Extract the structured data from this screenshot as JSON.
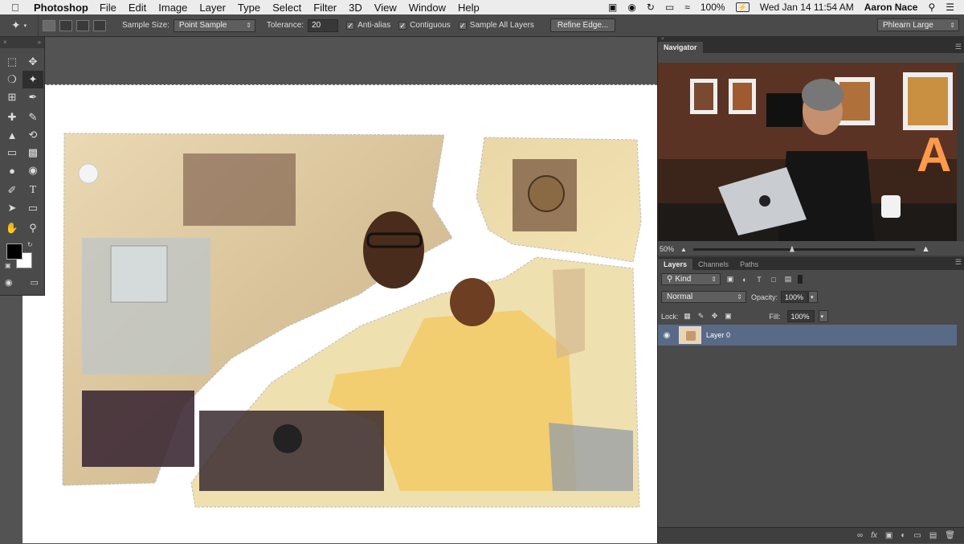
{
  "menubar": {
    "app_name": "Photoshop",
    "menus": [
      "File",
      "Edit",
      "Image",
      "Layer",
      "Type",
      "Select",
      "Filter",
      "3D",
      "View",
      "Window",
      "Help"
    ],
    "battery": "100%",
    "datetime": "Wed Jan 14  11:54 AM",
    "user": "Aaron Nace"
  },
  "options_bar": {
    "sample_size_label": "Sample Size:",
    "sample_size_value": "Point Sample",
    "tolerance_label": "Tolerance:",
    "tolerance_value": "20",
    "anti_alias": "Anti-alias",
    "contiguous": "Contiguous",
    "sample_all_layers": "Sample All Layers",
    "refine_edge": "Refine Edge...",
    "workspace": "Phlearn Large"
  },
  "navigator": {
    "tab": "Navigator",
    "zoom": "50%"
  },
  "layers_panel": {
    "tabs": [
      "Layers",
      "Channels",
      "Paths"
    ],
    "filter_kind": "Kind",
    "blend_mode": "Normal",
    "opacity_label": "Opacity:",
    "opacity_value": "100%",
    "lock_label": "Lock:",
    "fill_label": "Fill:",
    "fill_value": "100%",
    "layers": [
      {
        "name": "Layer 0",
        "visible": true,
        "selected": true
      }
    ]
  },
  "colors": {
    "foreground": "#000000",
    "background": "#ffffff",
    "selected_layer": "#596a87"
  }
}
